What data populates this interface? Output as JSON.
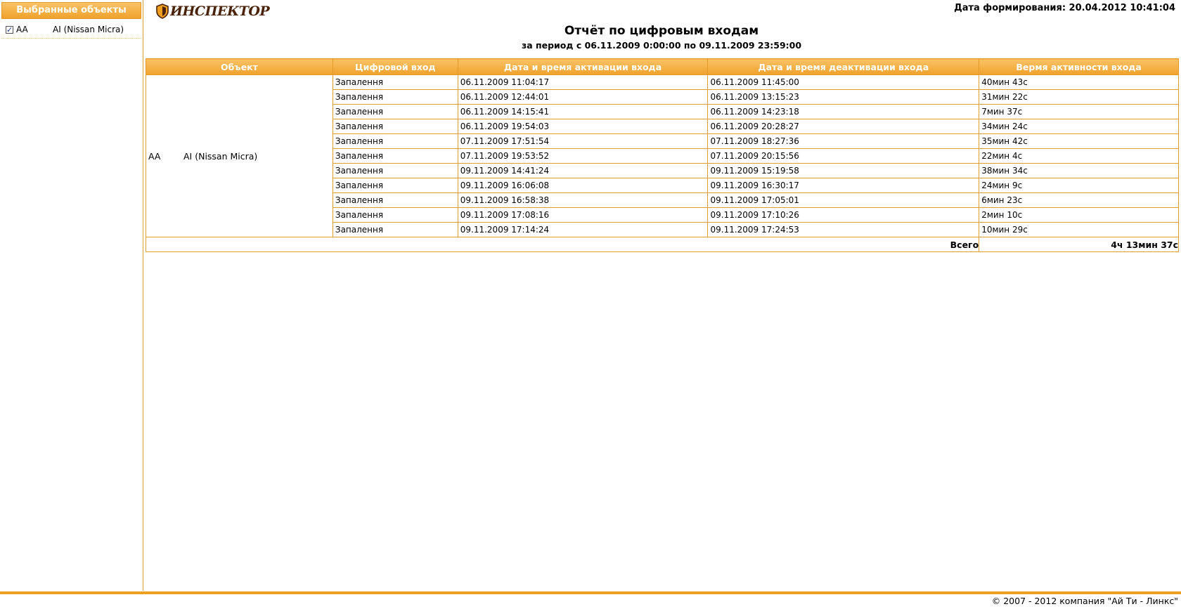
{
  "sidebar": {
    "title": "Выбранные объекты",
    "items": [
      {
        "code": "AA",
        "name": "AI (Nissan Micra)",
        "checked": true
      }
    ]
  },
  "header": {
    "logo_text": "ИНСПЕКТОР",
    "generated_label": "Дата формирования: 20.04.2012 10:41:04"
  },
  "report": {
    "title": "Отчёт по цифровым входам",
    "period": "за период с 06.11.2009 0:00:00 по 09.11.2009 23:59:00",
    "columns": [
      "Объект",
      "Цифровой вход",
      "Дата и время активации входа",
      "Дата и время деактивации входа",
      "Вермя активности входа"
    ],
    "object": {
      "code": "AA",
      "name": "AI (Nissan Micra)"
    },
    "rows": [
      {
        "input": "Запалення",
        "activated": "06.11.2009 11:04:17",
        "deactivated": "06.11.2009 11:45:00",
        "duration": "40мин 43с"
      },
      {
        "input": "Запалення",
        "activated": "06.11.2009 12:44:01",
        "deactivated": "06.11.2009 13:15:23",
        "duration": "31мин 22с"
      },
      {
        "input": "Запалення",
        "activated": "06.11.2009 14:15:41",
        "deactivated": "06.11.2009 14:23:18",
        "duration": "7мин 37с"
      },
      {
        "input": "Запалення",
        "activated": "06.11.2009 19:54:03",
        "deactivated": "06.11.2009 20:28:27",
        "duration": "34мин 24с"
      },
      {
        "input": "Запалення",
        "activated": "07.11.2009 17:51:54",
        "deactivated": "07.11.2009 18:27:36",
        "duration": "35мин 42с"
      },
      {
        "input": "Запалення",
        "activated": "07.11.2009 19:53:52",
        "deactivated": "07.11.2009 20:15:56",
        "duration": "22мин 4с"
      },
      {
        "input": "Запалення",
        "activated": "09.11.2009 14:41:24",
        "deactivated": "09.11.2009 15:19:58",
        "duration": "38мин 34с"
      },
      {
        "input": "Запалення",
        "activated": "09.11.2009 16:06:08",
        "deactivated": "09.11.2009 16:30:17",
        "duration": "24мин 9с"
      },
      {
        "input": "Запалення",
        "activated": "09.11.2009 16:58:38",
        "deactivated": "09.11.2009 17:05:01",
        "duration": "6мин 23с"
      },
      {
        "input": "Запалення",
        "activated": "09.11.2009 17:08:16",
        "deactivated": "09.11.2009 17:10:26",
        "duration": "2мин 10с"
      },
      {
        "input": "Запалення",
        "activated": "09.11.2009 17:14:24",
        "deactivated": "09.11.2009 17:24:53",
        "duration": "10мин 29с"
      }
    ],
    "total_label": "Всего",
    "total_value": "4ч 13мин 37с"
  },
  "footer": {
    "copyright": "© 2007 - 2012 компания \"Ай Ти - Линкс\""
  },
  "colors": {
    "accent": "#f0a22c",
    "border": "#e0a030",
    "logo": "#4a2208"
  }
}
